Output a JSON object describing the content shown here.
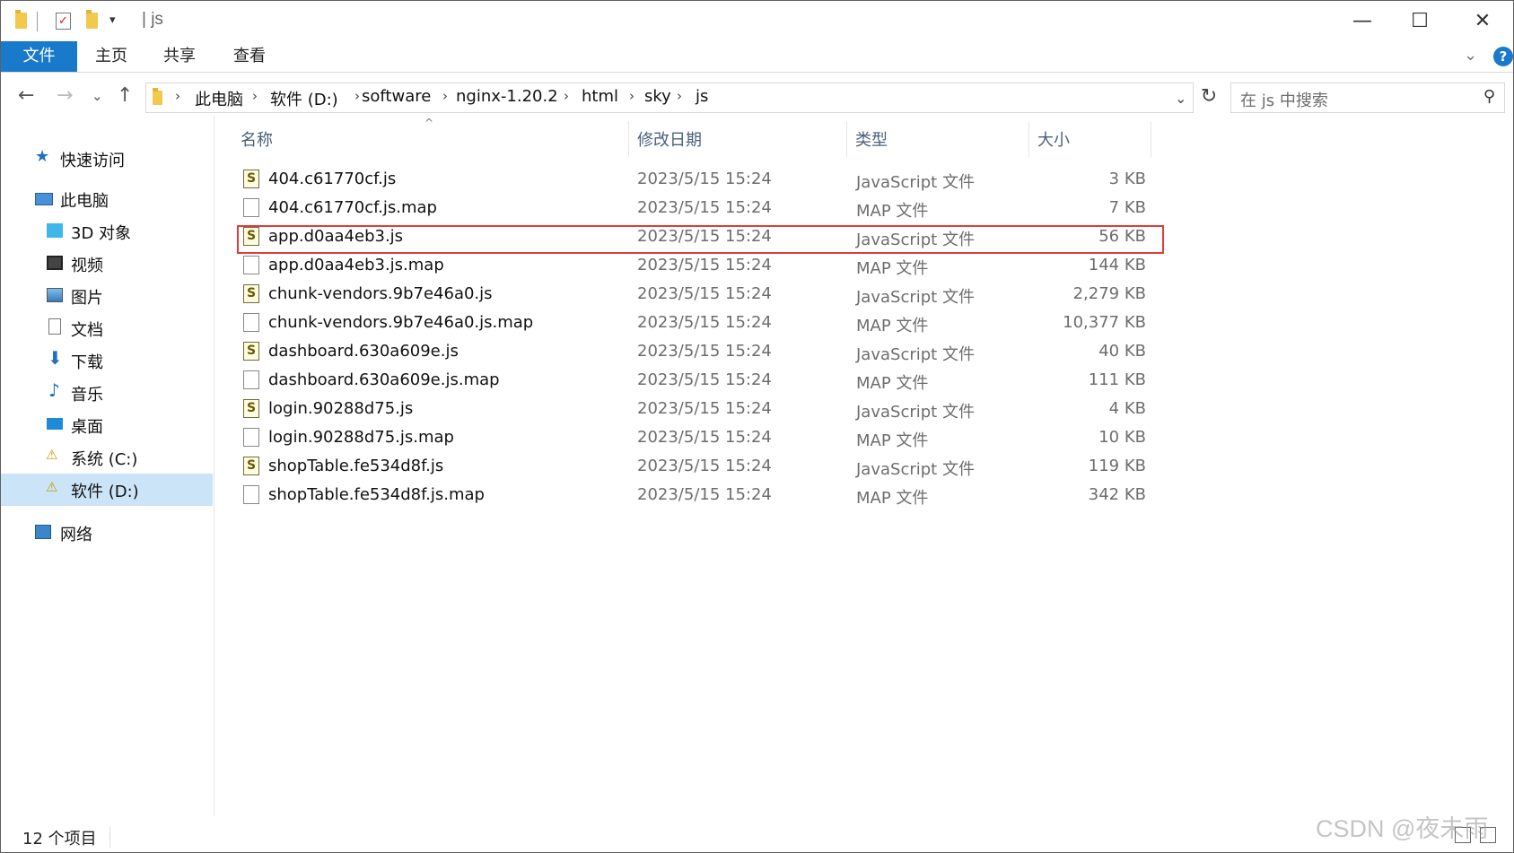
{
  "titlebar": {
    "title": "| js",
    "qat_arrow": "▾",
    "controls": {
      "minimize": "—",
      "maximize": "☐",
      "close": "✕"
    }
  },
  "ribbon": {
    "tabs": [
      "文件",
      "主页",
      "共享",
      "查看"
    ],
    "expand": "⌄",
    "help": "?"
  },
  "nav": {
    "back": "←",
    "forward": "→",
    "recent": "⌄",
    "up": "↑",
    "breadcrumbs": [
      "此电脑",
      "软件 (D:)",
      "software",
      "nginx-1.20.2",
      "html",
      "sky",
      "js"
    ],
    "dropdown": "⌄",
    "refresh": "↻",
    "search_placeholder": "在 js 中搜索",
    "search_icon": "search-icon"
  },
  "sidebar": {
    "items": [
      {
        "label": "快速访问",
        "icon": "star-icon"
      },
      {
        "label": "此电脑",
        "icon": "computer-icon"
      },
      {
        "label": "3D 对象",
        "icon": "cube-icon"
      },
      {
        "label": "视频",
        "icon": "video-icon"
      },
      {
        "label": "图片",
        "icon": "picture-icon"
      },
      {
        "label": "文档",
        "icon": "document-icon"
      },
      {
        "label": "下载",
        "icon": "download-icon"
      },
      {
        "label": "音乐",
        "icon": "music-icon"
      },
      {
        "label": "桌面",
        "icon": "desktop-icon"
      },
      {
        "label": "系统 (C:)",
        "icon": "drive-warning-icon"
      },
      {
        "label": "软件 (D:)",
        "icon": "drive-warning-icon",
        "selected": true
      },
      {
        "label": "网络",
        "icon": "network-icon"
      }
    ]
  },
  "files": {
    "columns": [
      "名称",
      "修改日期",
      "类型",
      "大小"
    ],
    "sort_indicator": "^",
    "rows": [
      {
        "name": "404.c61770cf.js",
        "date": "2023/5/15 15:24",
        "type": "JavaScript 文件",
        "size": "3 KB",
        "kind": "js"
      },
      {
        "name": "404.c61770cf.js.map",
        "date": "2023/5/15 15:24",
        "type": "MAP 文件",
        "size": "7 KB",
        "kind": "map"
      },
      {
        "name": "app.d0aa4eb3.js",
        "date": "2023/5/15 15:24",
        "type": "JavaScript 文件",
        "size": "56 KB",
        "kind": "js",
        "highlighted": true
      },
      {
        "name": "app.d0aa4eb3.js.map",
        "date": "2023/5/15 15:24",
        "type": "MAP 文件",
        "size": "144 KB",
        "kind": "map"
      },
      {
        "name": "chunk-vendors.9b7e46a0.js",
        "date": "2023/5/15 15:24",
        "type": "JavaScript 文件",
        "size": "2,279 KB",
        "kind": "js"
      },
      {
        "name": "chunk-vendors.9b7e46a0.js.map",
        "date": "2023/5/15 15:24",
        "type": "MAP 文件",
        "size": "10,377 KB",
        "kind": "map"
      },
      {
        "name": "dashboard.630a609e.js",
        "date": "2023/5/15 15:24",
        "type": "JavaScript 文件",
        "size": "40 KB",
        "kind": "js"
      },
      {
        "name": "dashboard.630a609e.js.map",
        "date": "2023/5/15 15:24",
        "type": "MAP 文件",
        "size": "111 KB",
        "kind": "map"
      },
      {
        "name": "login.90288d75.js",
        "date": "2023/5/15 15:24",
        "type": "JavaScript 文件",
        "size": "4 KB",
        "kind": "js"
      },
      {
        "name": "login.90288d75.js.map",
        "date": "2023/5/15 15:24",
        "type": "MAP 文件",
        "size": "10 KB",
        "kind": "map"
      },
      {
        "name": "shopTable.fe534d8f.js",
        "date": "2023/5/15 15:24",
        "type": "JavaScript 文件",
        "size": "119 KB",
        "kind": "js"
      },
      {
        "name": "shopTable.fe534d8f.js.map",
        "date": "2023/5/15 15:24",
        "type": "MAP 文件",
        "size": "342 KB",
        "kind": "map"
      }
    ]
  },
  "status": {
    "count": "12 个项目"
  },
  "watermark": "CSDN @夜未雨"
}
